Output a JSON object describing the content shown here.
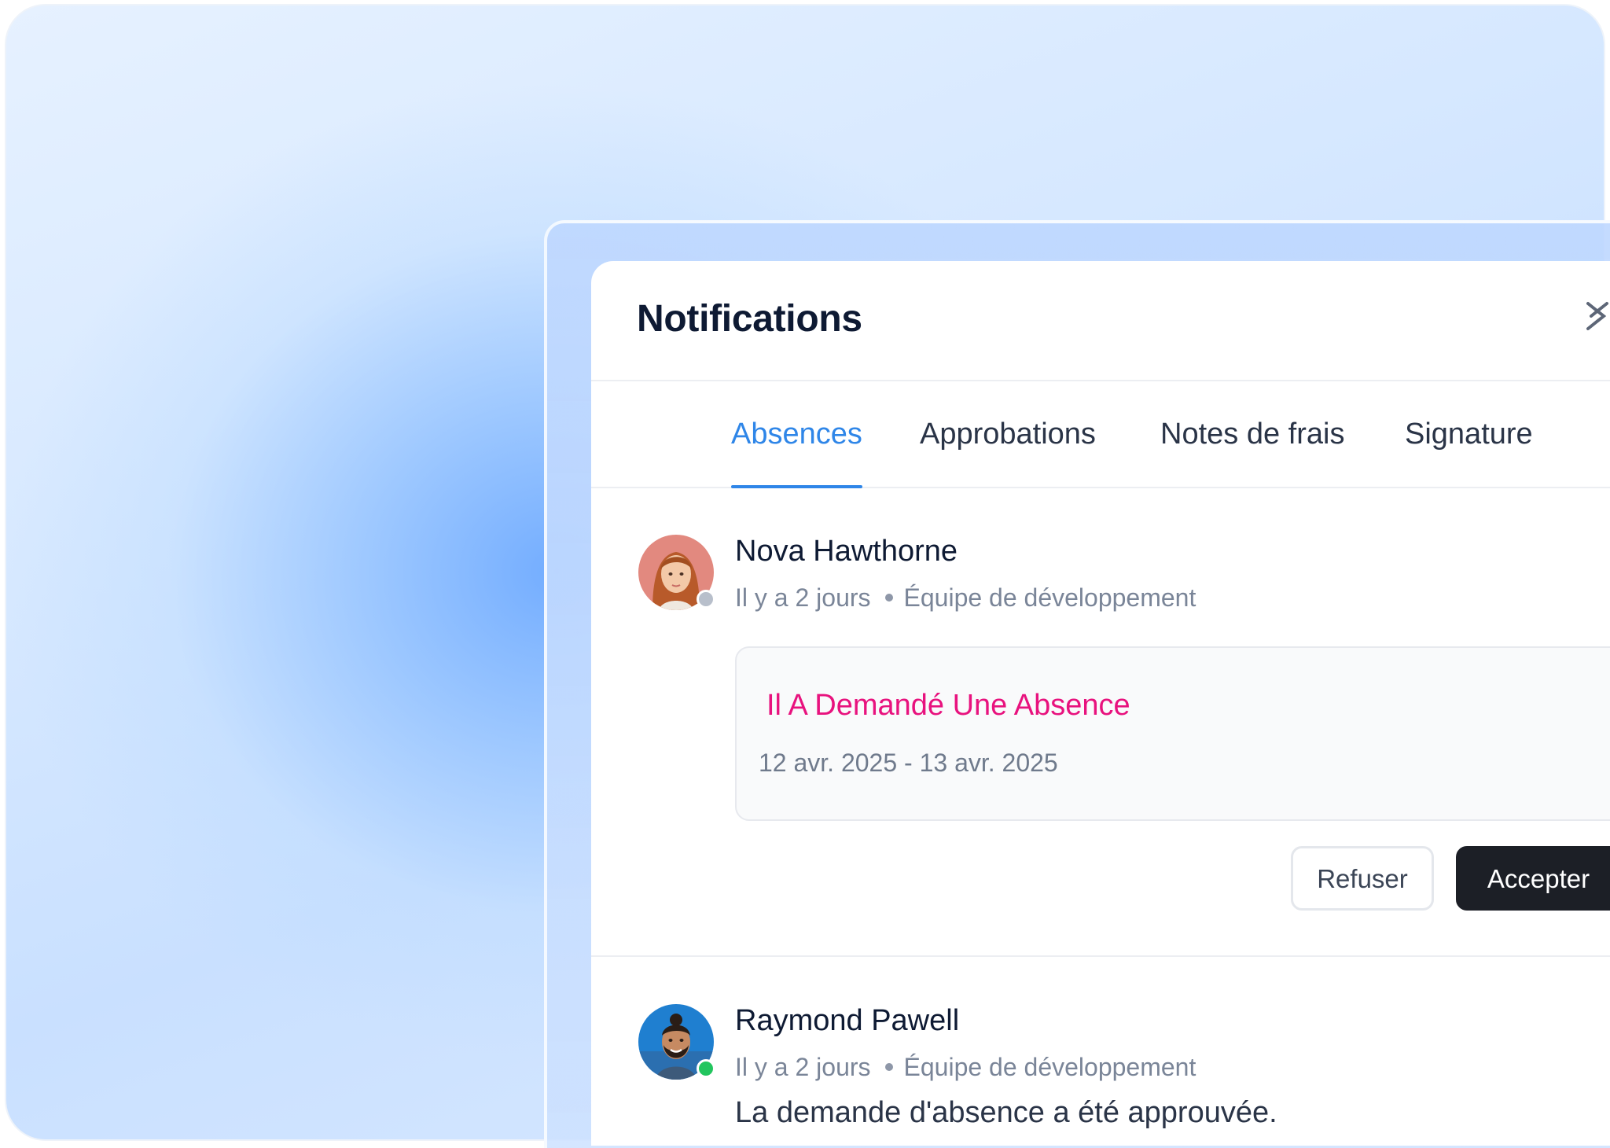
{
  "panel": {
    "title": "Notifications",
    "close_icon": "close-icon"
  },
  "tabs": [
    {
      "label": "Absences",
      "active": true
    },
    {
      "label": "Approbations",
      "active": false
    },
    {
      "label": "Notes de frais",
      "active": false
    },
    {
      "label": "Signature",
      "active": false
    }
  ],
  "notifications": [
    {
      "name": "Nova Hawthorne",
      "time": "Il y a 2 jours",
      "team": "Équipe de développement",
      "presence_color": "#b8bfcb",
      "request": {
        "title": "Il A Demandé Une Absence",
        "dates": "12 avr. 2025 - 13 avr. 2025"
      },
      "actions": {
        "refuse": "Refuser",
        "accept": "Accepter"
      }
    },
    {
      "name": "Raymond Pawell",
      "time": "Il y a 2 jours",
      "team": "Équipe de développement",
      "presence_color": "#22c55e",
      "message": "La demande d'absence a été approuvée."
    }
  ],
  "colors": {
    "accent": "#2f86e8",
    "request_title": "#e8127e",
    "primary_button": "#1c1f26"
  }
}
